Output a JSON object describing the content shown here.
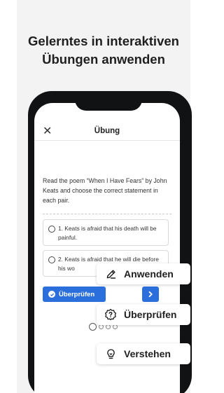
{
  "headline": {
    "line1": "Gelerntes in interaktiven",
    "line2": "Übungen anwenden"
  },
  "exercise": {
    "title": "Übung",
    "close_icon": "close-icon",
    "prompt": "Read the poem “When I Have Fears” by John Keats and choose the correct statement in each pair.",
    "options": [
      {
        "text": "1. Keats is afraid that his death will be painful."
      },
      {
        "text": "2. Keats is afraid that he will die before his wo"
      }
    ],
    "check_label": "Überprüfen",
    "accent": "#2a6fdb",
    "page_dots": 4,
    "active_dot": 1
  },
  "pills": {
    "apply": {
      "label": "Anwenden",
      "icon": "pencil-icon"
    },
    "check": {
      "label": "Überprüfen",
      "icon": "question-badge-icon"
    },
    "understand": {
      "label": "Verstehen",
      "icon": "lightbulb-icon"
    }
  }
}
